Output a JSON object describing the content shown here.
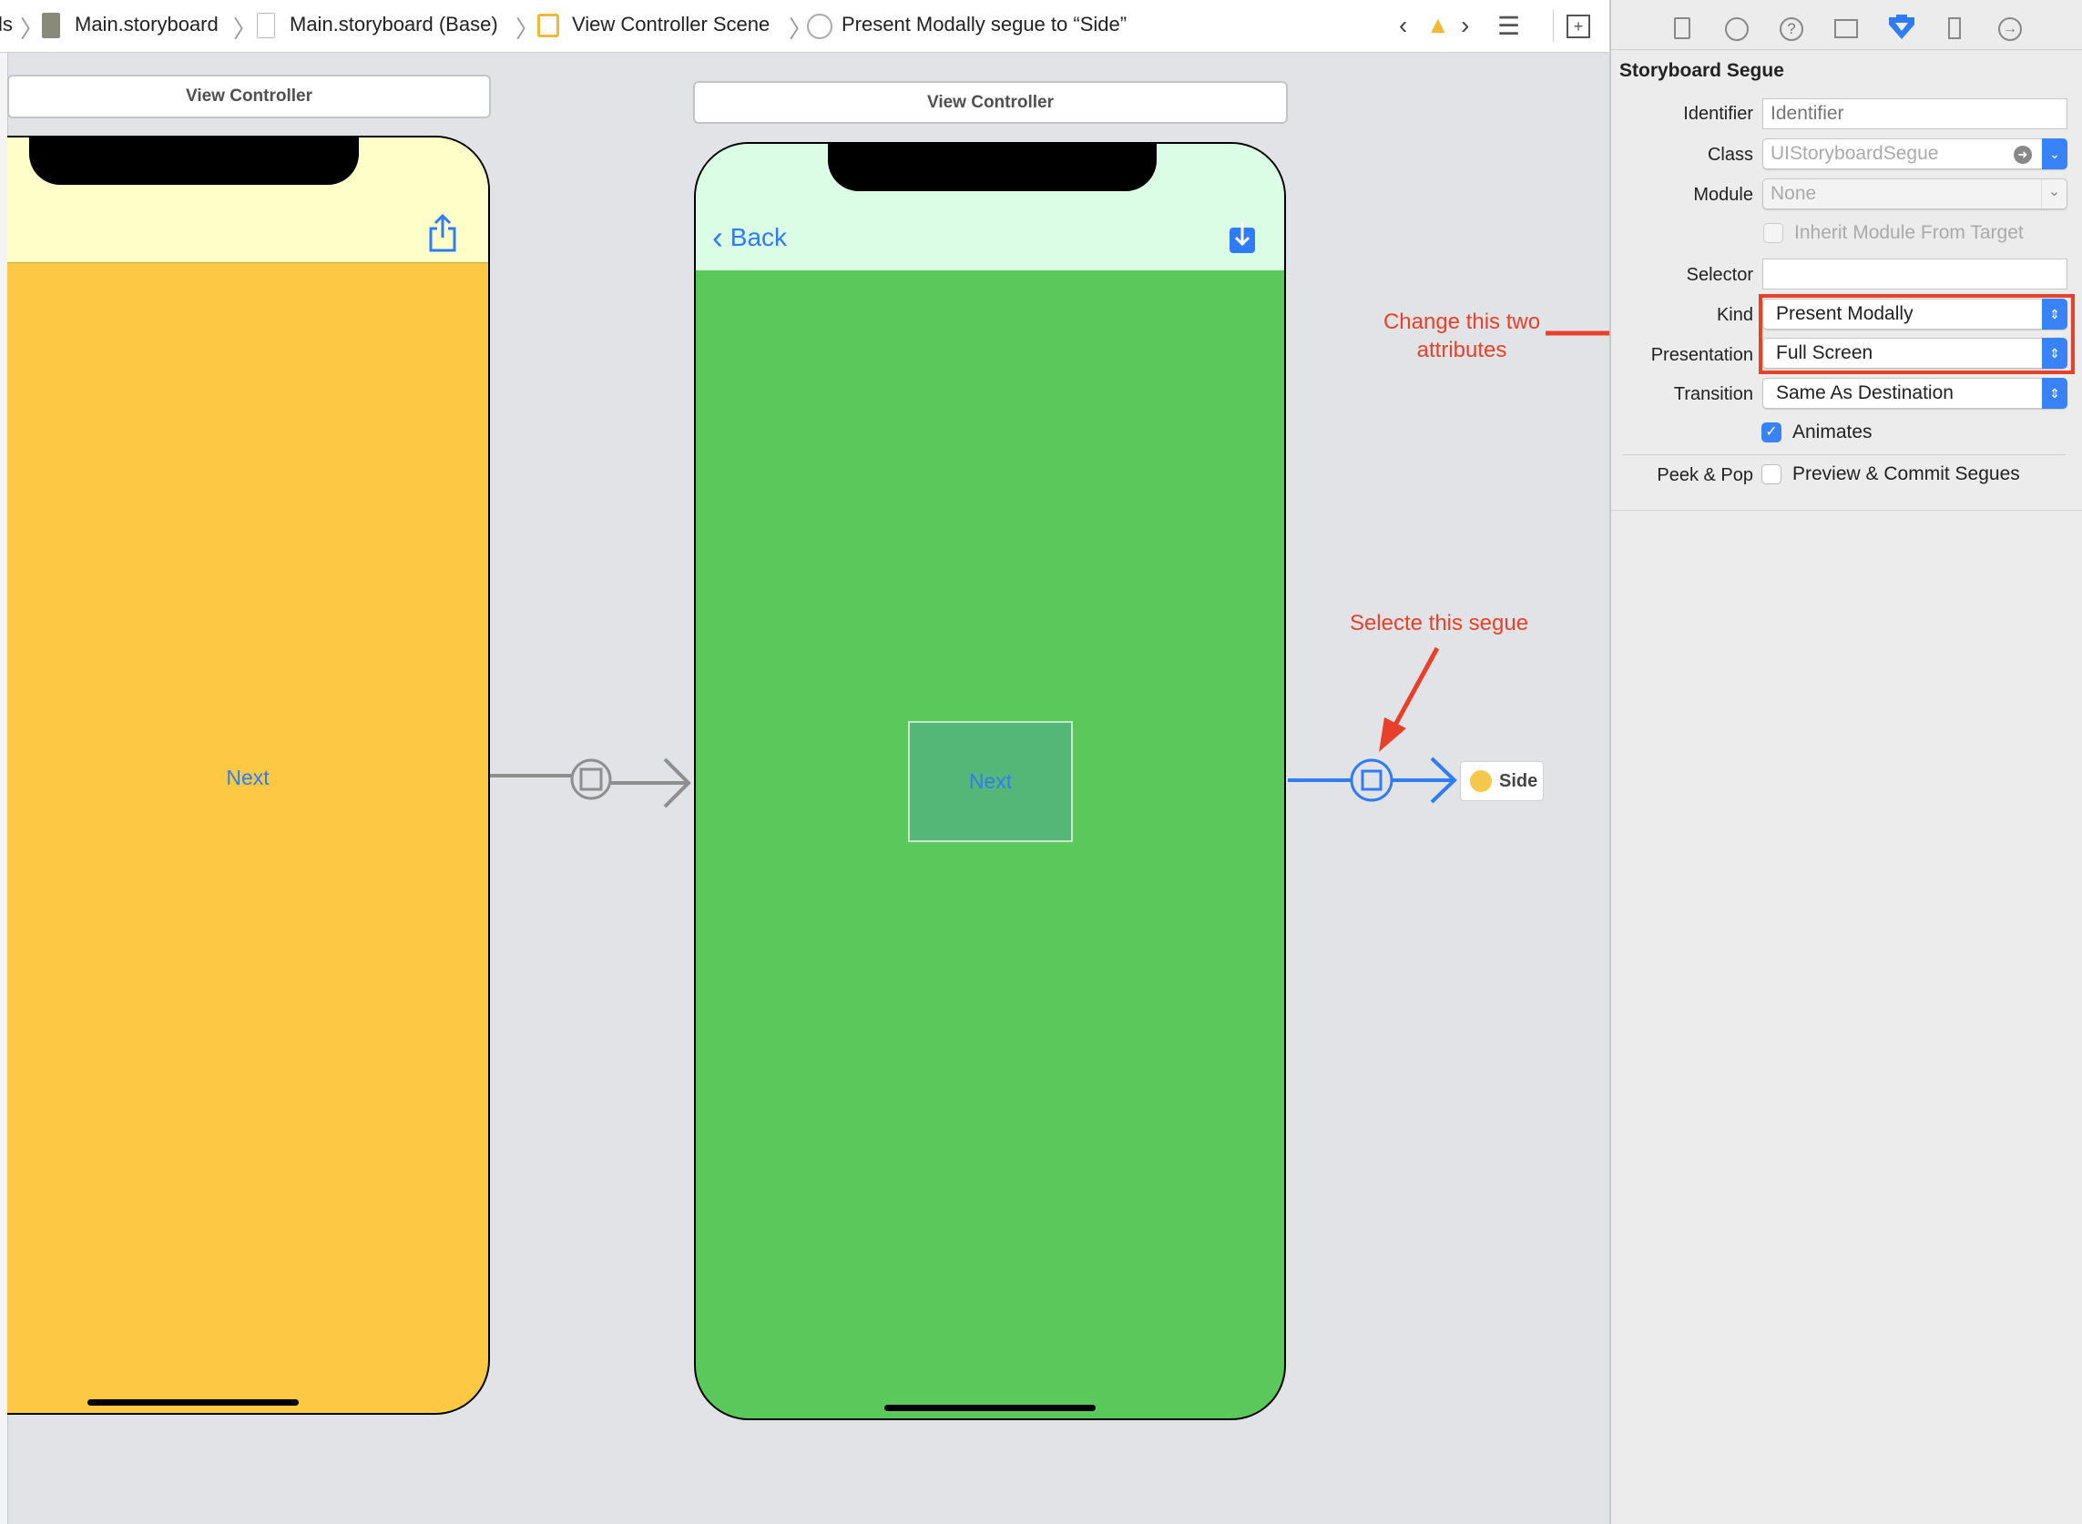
{
  "breadcrumb": {
    "items": [
      "ls",
      "Main.storyboard",
      "Main.storyboard (Base)",
      "View Controller Scene",
      "Present Modally segue to “Side”"
    ]
  },
  "canvas": {
    "left_scene": {
      "title": "View Controller",
      "next_label": "Next",
      "nav_color": "#fefec8",
      "body_color": "#fdc844",
      "icon": "share-icon"
    },
    "middle_scene": {
      "title": "View Controller",
      "back_label": "Back",
      "next_label": "Next",
      "nav_color": "#dbfde6",
      "body_color": "#5bc85c",
      "icon": "download-icon"
    },
    "destination": {
      "label": "Side"
    },
    "annotations": {
      "select_segue": "Selecte this segue",
      "change_attrs_line1": "Change this two",
      "change_attrs_line2": "attributes",
      "color": "#e8402a"
    }
  },
  "inspector": {
    "tabs": [
      "file-inspector",
      "history-inspector",
      "quick-help",
      "identity-inspector",
      "attributes-inspector",
      "size-inspector",
      "connections-inspector"
    ],
    "active_tab": "attributes-inspector",
    "title": "Storyboard Segue",
    "identifier": {
      "label": "Identifier",
      "value": "",
      "placeholder": "Identifier"
    },
    "class": {
      "label": "Class",
      "placeholder": "UIStoryboardSegue"
    },
    "module": {
      "label": "Module",
      "placeholder": "None"
    },
    "inherit_module": {
      "label": "Inherit Module From Target",
      "checked": false
    },
    "selector": {
      "label": "Selector",
      "value": ""
    },
    "kind": {
      "label": "Kind",
      "value": "Present Modally"
    },
    "presentation": {
      "label": "Presentation",
      "value": "Full Screen"
    },
    "transition": {
      "label": "Transition",
      "value": "Same As Destination"
    },
    "animates": {
      "label": "Animates",
      "checked": true
    },
    "peek_pop": {
      "label": "Peek & Pop",
      "option": "Preview & Commit Segues",
      "checked": false
    }
  }
}
